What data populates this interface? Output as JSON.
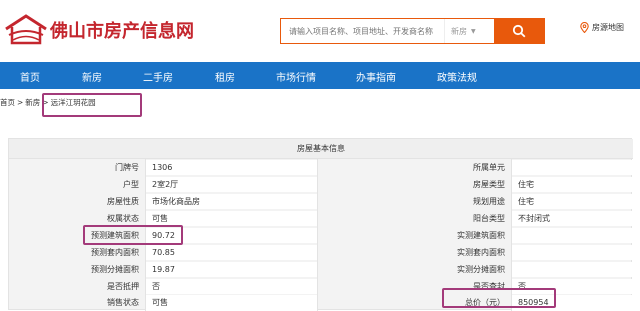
{
  "header": {
    "site_name": "佛山市房产信息网",
    "search_placeholder": "请输入项目名称、项目地址、开发商名称",
    "search_type": "新房",
    "map_link": "房源地图"
  },
  "nav": {
    "items": [
      "首页",
      "新房",
      "二手房",
      "租房",
      "市场行情",
      "办事指南",
      "政策法规"
    ]
  },
  "breadcrumb": {
    "items": [
      "首页",
      "新房",
      "远洋江玥花园"
    ]
  },
  "panel": {
    "title": "房屋基本信息",
    "left_rows": [
      {
        "label": "门牌号",
        "value": "1306"
      },
      {
        "label": "户型",
        "value": "2室2厅"
      },
      {
        "label": "房屋性质",
        "value": "市场化商品房"
      },
      {
        "label": "权属状态",
        "value": "可售"
      },
      {
        "label": "预测建筑面积",
        "value": "90.72"
      },
      {
        "label": "预测套内面积",
        "value": "70.85"
      },
      {
        "label": "预测分摊面积",
        "value": "19.87"
      },
      {
        "label": "是否抵押",
        "value": "否"
      },
      {
        "label": "销售状态",
        "value": "可售"
      }
    ],
    "right_rows": [
      {
        "label": "所属单元",
        "value": ""
      },
      {
        "label": "房屋类型",
        "value": "住宅"
      },
      {
        "label": "规划用途",
        "value": "住宅"
      },
      {
        "label": "阳台类型",
        "value": "不封闭式"
      },
      {
        "label": "实测建筑面积",
        "value": ""
      },
      {
        "label": "实测套内面积",
        "value": ""
      },
      {
        "label": "实测分摊面积",
        "value": ""
      },
      {
        "label": "是否查封",
        "value": "否"
      },
      {
        "label": "总价（元）",
        "value": "850954"
      }
    ]
  },
  "colors": {
    "brand_red": "#c4262e",
    "accent_orange": "#e8590c",
    "nav_blue": "#1a73c7",
    "highlight_box": "#a33a7a"
  }
}
